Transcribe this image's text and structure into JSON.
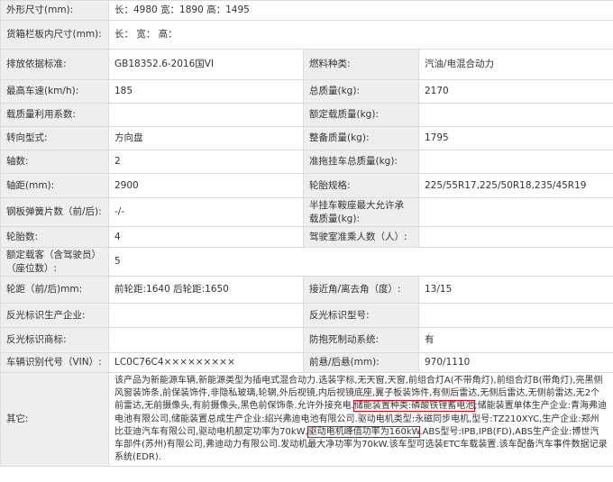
{
  "rows": [
    {
      "type": "full",
      "label": "外形尺寸(mm):",
      "value": "长：4980 宽：1890 高：1495"
    },
    {
      "type": "full",
      "label": "货箱栏板内尺寸(mm):",
      "value": "长： 宽： 高："
    },
    {
      "type": "pair",
      "l1": "排放依据标准:",
      "v1": "GB18352.6-2016国VI",
      "l2": "燃料种类:",
      "v2": "汽油/电混合动力"
    },
    {
      "type": "pair",
      "l1": "最高车速(km/h):",
      "v1": "185",
      "l2": "总质量(kg):",
      "v2": "2170"
    },
    {
      "type": "pair",
      "l1": "载质量利用系数:",
      "v1": "",
      "l2": "额定载质量(kg):",
      "v2": ""
    },
    {
      "type": "pair",
      "l1": "转向型式:",
      "v1": "方向盘",
      "l2": "整备质量(kg):",
      "v2": "1795"
    },
    {
      "type": "pair",
      "l1": "轴数:",
      "v1": "2",
      "l2": "准拖挂车总质量(kg):",
      "v2": ""
    },
    {
      "type": "pair",
      "l1": "轴距(mm):",
      "v1": "2900",
      "l2": "轮胎规格:",
      "v2": "225/55R17,225/50R18,235/45R19"
    },
    {
      "type": "pair",
      "l1": "钢板弹簧片数（前/后):",
      "v1": "-/-",
      "l2": "半挂车鞍座最大允许承载质量(kg):",
      "v2": ""
    },
    {
      "type": "pair",
      "l1": "轮胎数:",
      "v1": "4",
      "l2": "驾驶室准乘人数（人）:",
      "v2": ""
    },
    {
      "type": "full",
      "label": "额定载客（含驾驶员）（座位数）:",
      "value": "5"
    },
    {
      "type": "pair",
      "l1": "轮距（前/后)mm:",
      "v1": "前轮距:1640 后轮距:1650",
      "l2": "接近角/离去角（度）:",
      "v2": "13/15"
    },
    {
      "type": "pair",
      "l1": "反光标识生产企业:",
      "v1": "",
      "l2": "反光标识型号:",
      "v2": ""
    },
    {
      "type": "pair",
      "l1": "反光标识商标:",
      "v1": "",
      "l2": "防抱死制动系统:",
      "v2": "有"
    },
    {
      "type": "pair",
      "l1": "车辆识别代号（VIN）:",
      "v1": "LC0C76C4×××××××××",
      "l2": "前悬/后悬(mm):",
      "v2": "970/1110"
    }
  ],
  "other": {
    "label": "其它:",
    "segments": [
      {
        "t": "该产品为新能源车辆,新能源类型为插电式混合动力.选装字标,无天窗,天窗,前组合灯A(不带角灯),前组合灯B(带角灯),亮黑侧风窗装饰条,前保装饰件,非隐私玻璃,轮辋,外后视镜,内后视镜底座,翼子板装饰件,有侧后雷达,无侧后雷达,无侧前雷达,无2个前雷达,无前摄像头,有前摄像头,黑色前保饰条.允许外接充电.",
        "hl": false
      },
      {
        "t": "储能装置种类:磷酸铁锂蓄电池",
        "hl": true
      },
      {
        "t": ";储能装置单体生产企业:青海弗迪电池有限公司,储能装置总成生产企业:绍兴弗迪电池有限公司.驱动电机类型:永磁同步电机,型号:TZ210XYC,生产企业:郑州比亚迪汽车有限公司,驱动电机额定功率为70kW,",
        "hl": false
      },
      {
        "t": "驱动电机峰值功率为160kW",
        "hl": true
      },
      {
        "t": ".ABS型号:IPB,IPB(FD),ABS生产企业:博世汽车部件(苏州)有限公司,弗迪动力有限公司.发动机最大净功率为70kW.该车型可选装ETC车载装置.该车配备汽车事件数据记录系统(EDR).",
        "hl": false
      }
    ]
  }
}
